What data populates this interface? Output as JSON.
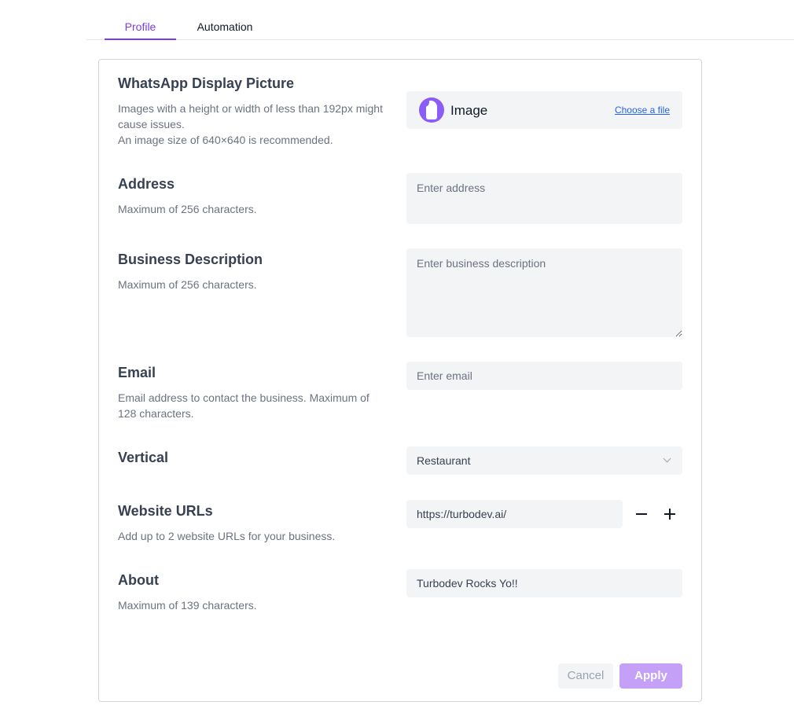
{
  "tabs": [
    {
      "label": "Profile",
      "active": true
    },
    {
      "label": "Automation",
      "active": false
    }
  ],
  "display_picture": {
    "title": "WhatsApp Display Picture",
    "desc_line1": "Images with a height or width of less than 192px might cause issues.",
    "desc_line2": "An image size of 640×640 is recommended.",
    "image_label": "Image",
    "choose_file_label": "Choose a file"
  },
  "address": {
    "title": "Address",
    "desc": "Maximum of 256 characters.",
    "placeholder": "Enter address",
    "value": ""
  },
  "business_description": {
    "title": "Business Description",
    "desc": "Maximum of 256 characters.",
    "placeholder": "Enter business description",
    "value": ""
  },
  "email": {
    "title": "Email",
    "desc": "Email address to contact the business. Maximum of 128 characters.",
    "placeholder": "Enter email",
    "value": ""
  },
  "vertical": {
    "title": "Vertical",
    "selected": "Restaurant"
  },
  "website_urls": {
    "title": "Website URLs",
    "desc": "Add up to 2 website URLs for your business.",
    "urls": [
      "https://turbodev.ai/"
    ]
  },
  "about": {
    "title": "About",
    "desc": "Maximum of 139 characters.",
    "value": "Turbodev Rocks Yo!!"
  },
  "actions": {
    "cancel_label": "Cancel",
    "apply_label": "Apply"
  },
  "colors": {
    "accent": "#7c3aed",
    "apply_disabled": "#c4a1f7",
    "field_bg": "#f3f4f6",
    "link": "#2563eb"
  },
  "icons": [
    "app-logo-icon",
    "chevron-down-icon",
    "minus-icon",
    "plus-icon"
  ]
}
